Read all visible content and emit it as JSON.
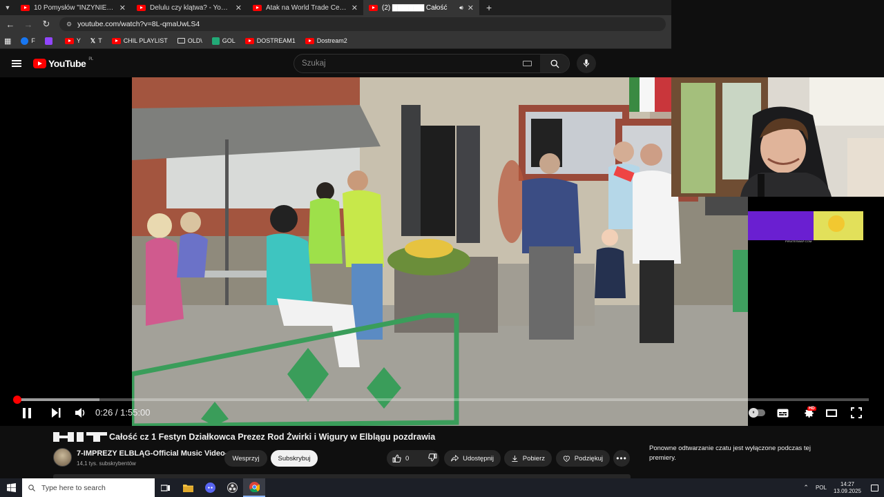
{
  "browser": {
    "tabs": [
      {
        "title": "10 Pomysłów \"INŻYNIERÓW\" z",
        "active": false
      },
      {
        "title": "Delulu czy klątwa? - YouTube",
        "active": false
      },
      {
        "title": "Atak na World Trade Center (c",
        "active": false
      },
      {
        "title": "(2) ▇▇▇▇▇▇ Całość",
        "active": true
      }
    ],
    "url": "youtube.com/watch?v=8L-qmaUwLS4",
    "bookmarks": [
      "F",
      "",
      "Y",
      "T",
      "CHIL PLAYLIST",
      "OLD\\",
      "GOL",
      "DOSTREAM1",
      "Dostream2"
    ]
  },
  "youtube": {
    "logo_text": "YouTube",
    "region": "PL",
    "search_placeholder": "Szukaj"
  },
  "player": {
    "current_time": "0:26",
    "duration": "1:55:00",
    "time_display": "0:26 / 1:55:00",
    "progress_fraction": 0.004,
    "buffered_fraction": 0.1,
    "ad_caption": "PIRATESWAP.COM",
    "hd_badge": "HD"
  },
  "video": {
    "title": "Całość cz 1 Festyn Działkowca Prezez Rod Żwirki i Wigury w Elblągu pozdrawia",
    "title_prefix_logo": "HIT",
    "channel_name": "7-IMPREZY ELBLĄG-Official Music Video-",
    "subscribers": "14,1 tys. subskrybentów",
    "join_label": "Wesprzyj",
    "subscribe_label": "Subskrybuj",
    "likes": "0",
    "share_label": "Udostępnij",
    "download_label": "Pobierz",
    "thanks_label": "Podziękuj"
  },
  "chat": {
    "message": "Ponowne odtwarzanie czatu jest wyłączone podczas tej premiery."
  },
  "taskbar": {
    "search_placeholder": "Type here to search",
    "language": "POL",
    "time": "14:27",
    "date": "13.09.2025"
  },
  "colors": {
    "accent": "#ff0000",
    "background": "#0f0f0f",
    "pill": "#272727"
  }
}
